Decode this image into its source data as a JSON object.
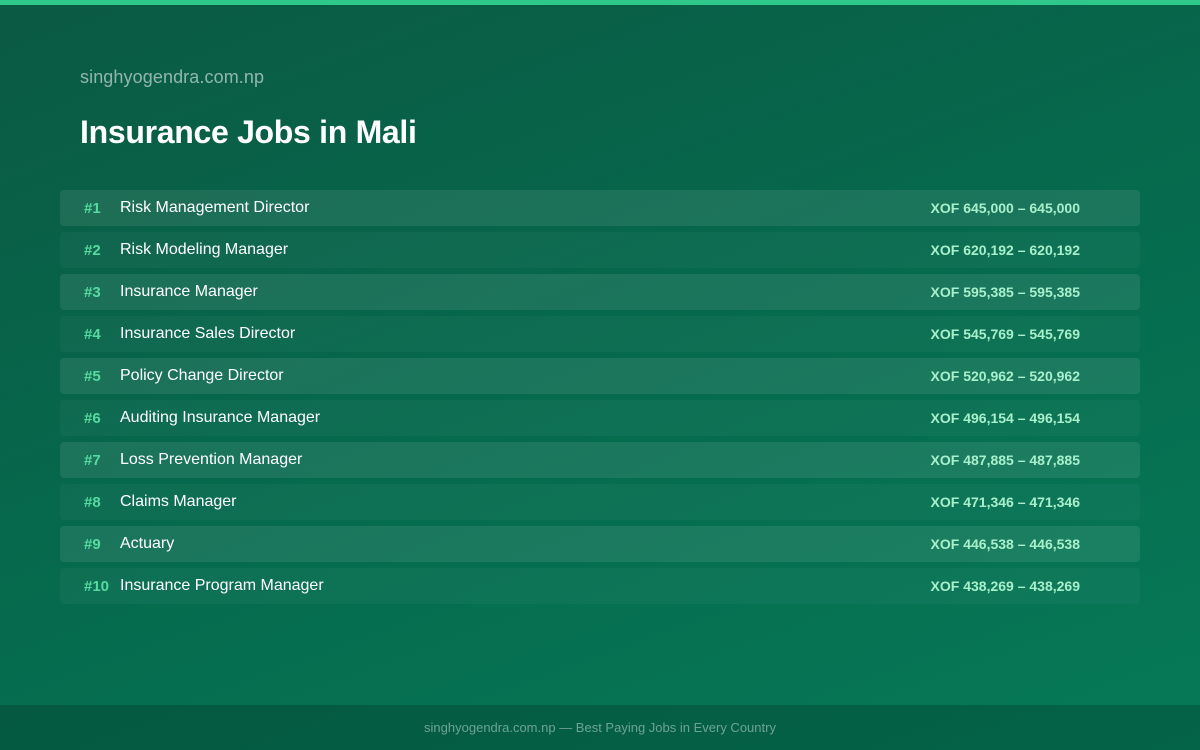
{
  "header": {
    "site_name": "singhyogendra.com.np",
    "title": "Insurance Jobs in Mali"
  },
  "jobs": [
    {
      "rank": "#1",
      "title": "Risk Management Director",
      "salary": "XOF 645,000 – 645,000"
    },
    {
      "rank": "#2",
      "title": "Risk Modeling Manager",
      "salary": "XOF 620,192 – 620,192"
    },
    {
      "rank": "#3",
      "title": "Insurance Manager",
      "salary": "XOF 595,385 – 595,385"
    },
    {
      "rank": "#4",
      "title": "Insurance Sales Director",
      "salary": "XOF 545,769 – 545,769"
    },
    {
      "rank": "#5",
      "title": "Policy Change Director",
      "salary": "XOF 520,962 – 520,962"
    },
    {
      "rank": "#6",
      "title": "Auditing Insurance Manager",
      "salary": "XOF 496,154 – 496,154"
    },
    {
      "rank": "#7",
      "title": "Loss Prevention Manager",
      "salary": "XOF 487,885 – 487,885"
    },
    {
      "rank": "#8",
      "title": "Claims Manager",
      "salary": "XOF 471,346 – 471,346"
    },
    {
      "rank": "#9",
      "title": "Actuary",
      "salary": "XOF 446,538 – 446,538"
    },
    {
      "rank": "#10",
      "title": "Insurance Program Manager",
      "salary": "XOF 438,269 – 438,269"
    }
  ],
  "footer": {
    "text": "singhyogendra.com.np — Best Paying Jobs in Every Country"
  },
  "colors": {
    "accent": "#2ec98a",
    "rank": "#57d9a0",
    "salary": "#a8f0cc",
    "background": "#06684c"
  }
}
